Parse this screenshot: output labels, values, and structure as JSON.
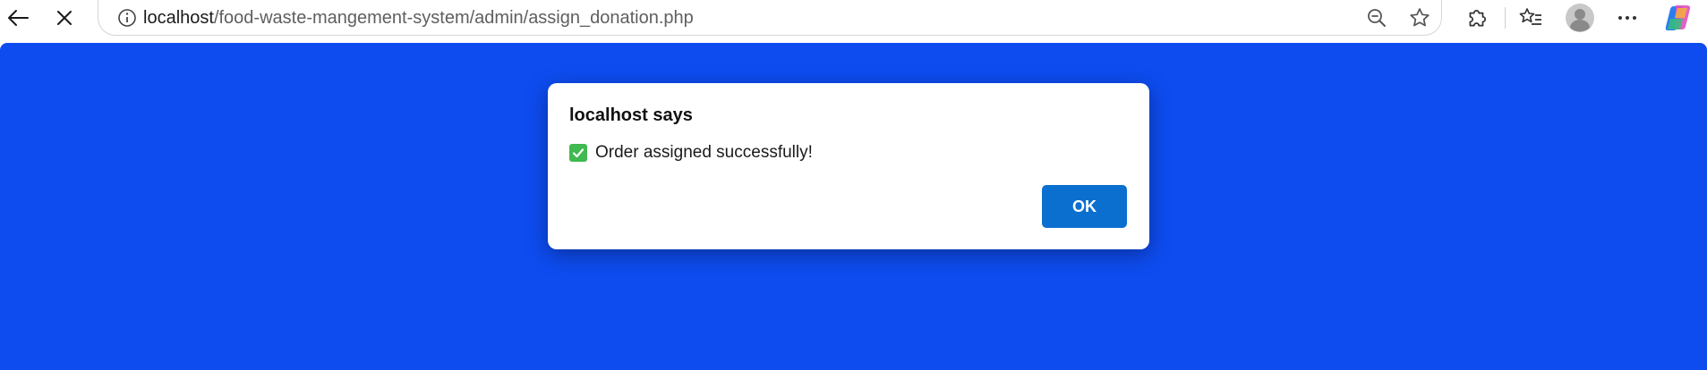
{
  "browser": {
    "url_host": "localhost",
    "url_path": "/food-waste-mangement-system/admin/assign_donation.php"
  },
  "dialog": {
    "title": "localhost says",
    "message": "Order assigned successfully!",
    "message_icon": "check-mark-button-icon",
    "ok_label": "OK"
  },
  "colors": {
    "page_background": "#0e4cf0",
    "ok_button": "#0b6fd0",
    "check_icon": "#3fb950"
  }
}
